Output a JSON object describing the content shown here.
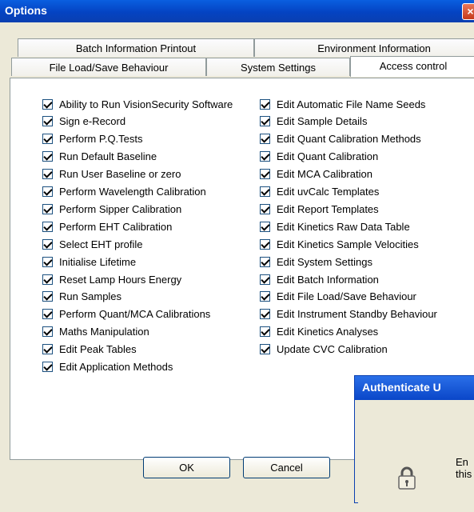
{
  "window": {
    "title": "Options",
    "close_glyph": "×"
  },
  "tabs": {
    "row1": [
      "Batch Information Printout",
      "Environment Information"
    ],
    "row2": [
      "File Load/Save Behaviour",
      "System Settings",
      "Access control"
    ],
    "active": "Access control"
  },
  "left_column": [
    "Ability to Run VisionSecurity Software",
    "Sign e-Record",
    "Perform P.Q.Tests",
    "Run Default Baseline",
    "Run User Baseline or zero",
    "Perform Wavelength Calibration",
    "Perform Sipper Calibration",
    "Perform EHT Calibration",
    "Select EHT profile",
    "Initialise Lifetime",
    "Reset Lamp Hours Energy",
    "Run Samples",
    "Perform Quant/MCA Calibrations",
    "Maths Manipulation",
    "Edit Peak Tables",
    "Edit Application Methods"
  ],
  "right_column": [
    "Edit Automatic File Name Seeds",
    "Edit Sample Details",
    "Edit Quant Calibration Methods",
    "Edit Quant Calibration",
    "Edit MCA Calibration",
    "Edit uvCalc Templates",
    "Edit Report Templates",
    "Edit Kinetics Raw Data Table",
    "Edit Kinetics Sample Velocities",
    "Edit System Settings",
    "Edit Batch Information",
    "Edit File Load/Save Behaviour",
    "Edit Instrument Standby Behaviour",
    "Edit Kinetics Analyses",
    "Update CVC Calibration"
  ],
  "buttons": {
    "ok": "OK",
    "cancel": "Cancel"
  },
  "auth_dialog": {
    "title": "Authenticate U",
    "text_line1": "En",
    "text_line2": "this",
    "icon": "lock-icon"
  }
}
